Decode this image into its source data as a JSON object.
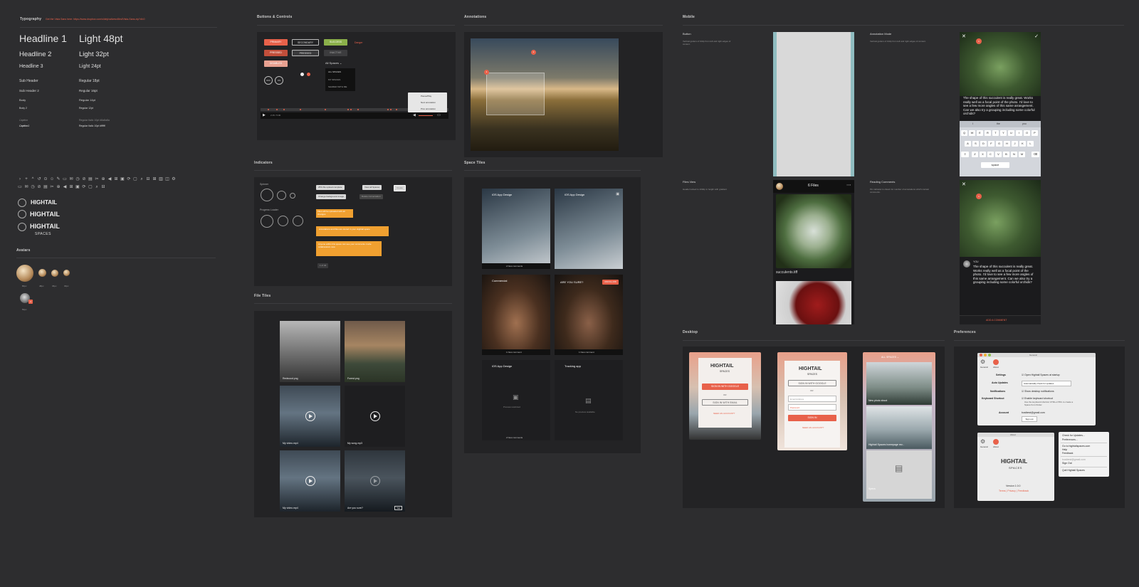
{
  "typography": {
    "title": "Typography",
    "font_note": "Get the Vista Sans here: https://www.dropbox.com/s/ldnj/xaltvesx8bnl/Vista-Sans.zip?dl=0",
    "rows": [
      {
        "left": "Headline 1",
        "right": "Light 48pt"
      },
      {
        "left": "Headline 2",
        "right": "Light 32pt"
      },
      {
        "left": "Headline 3",
        "right": "Light 24pt"
      },
      {
        "left": "Sub Header",
        "right": "Regular 18pt"
      },
      {
        "left": "Sub Header 2",
        "right": "Regular 16pt"
      },
      {
        "left": "Body",
        "right": "Regular 14pt"
      },
      {
        "left": "Body 2",
        "right": "Regular 12pt"
      },
      {
        "left": "Caption",
        "right": "Regular Italic 10pt #8a8a8a"
      },
      {
        "left": "Caption1",
        "right": "Regular Italic 10pt #ffffff"
      }
    ]
  },
  "logos": {
    "wordmark": "HIGHTAIL",
    "sub": "SPACES"
  },
  "avatars": {
    "title": "Avatars",
    "sizes": [
      "80px",
      "48px",
      "36px",
      "30px"
    ],
    "badge_size": "50px",
    "badge": "3"
  },
  "buttons": {
    "title": "Buttons & Controls",
    "primary": "PRIMARY",
    "secondary": "SECONDARY",
    "success": "SUCCESS",
    "danger": "Danger",
    "pressed1": "PRESSED",
    "pressed2": "PRESSED",
    "inactive": "INACTIVE",
    "disabled": "DISABLED",
    "dropdown_label": "All Spaces",
    "dropdown_items": [
      "ALL SPACES",
      "MY SPACES",
      "SHARED WITH ME"
    ],
    "round1": "OFF",
    "round2": "ON",
    "time": "2:15 / 5:00",
    "menu_items": [
      "Pause/Play",
      "Next annotation",
      "Prev annotation"
    ]
  },
  "indicators": {
    "title": "Indicators",
    "spinner": "Spinner",
    "progress": "Progress Loader",
    "pills": [
      "25% file upload complete",
      "View all Spaces",
      "Change background image",
      "Delete conversation",
      "Create"
    ],
    "toast1": "Files will be uploaded with all changes",
    "toast2": "Annotations and files are stored in your Hightail space",
    "toast3": "Anyone within this space can see your comments. Invite collaborators now.",
    "counter": "1 of 34"
  },
  "file_tiles": {
    "title": "File Tiles",
    "items": [
      "Redwood.png",
      "Forest.png",
      "My video.mp4",
      "My song.mp3",
      "My video.mp4",
      "Are you sure?"
    ],
    "confirm": "Yes"
  },
  "annotations": {
    "title": "Annotations",
    "pin1": "1",
    "pin2": "2"
  },
  "space_tiles": {
    "title": "Space Tiles",
    "items": [
      {
        "name": "iOS App Design",
        "foot": "2 New comments"
      },
      {
        "name": "iOS App Design",
        "foot": ""
      },
      {
        "name": "Commercial",
        "foot": "1 New comment"
      },
      {
        "name": "ARE YOU SURE?",
        "foot": "1 New comment",
        "action": "UNFOLLOW"
      },
      {
        "name": "iOS App Design",
        "foot": "2 New comments",
        "note": "Preview restricted"
      },
      {
        "name": "Tracking app",
        "foot": "",
        "note": "No preview available"
      }
    ]
  },
  "mobile": {
    "title": "Mobile",
    "button_h": "Button",
    "button_desc": "Vertical gutters of 10dp from left and right edges of content.",
    "annot_h": "Annotation Mode",
    "annot_desc": "Vertical gutters of 10dp from left and right edges of content.",
    "files_h": "Files View",
    "files_desc": "Header locked to 100dp in height with gradient",
    "reading_h": "Reading Comments",
    "reading_desc": "Pin indicator is shown for number of annotations which contain comments.",
    "files_count": "6 Files",
    "filename": "succulents.tiff",
    "comment": "The shape of this succulent is really great. Works really well as a focal point of the photo. I'd love to see a few more angles of this same arrangement. Can we also try a grouping including some colorful orchids?",
    "you": "YOU",
    "add_comment": "ADD A COMMENT",
    "kb_row1": [
      "Q",
      "W",
      "E",
      "R",
      "T",
      "Y",
      "U",
      "I",
      "O",
      "P"
    ],
    "kb_row2": [
      "A",
      "S",
      "D",
      "F",
      "G",
      "H",
      "J",
      "K",
      "L"
    ],
    "kb_row3": [
      "Z",
      "X",
      "C",
      "V",
      "B",
      "N",
      "M"
    ],
    "suggest": [
      "I",
      "the",
      "you"
    ],
    "space": "space",
    "pin": "1"
  },
  "desktop": {
    "title": "Desktop",
    "logo": "HIGHTAIL",
    "logo_sub": "SPACES",
    "google": "SIGN IN WITH GOOGLE",
    "or": "OR",
    "email_btn": "SIGN IN WITH EMAIL",
    "need": "NEED AN ACCOUNT?",
    "email_ph": "Email Address",
    "pw_ph": "Password",
    "signin": "SIGN IN",
    "all_spaces": "ALL SPACES",
    "items": [
      "New photo shoot",
      "Hightail Spaces homepage rev...",
      "Specs"
    ]
  },
  "prefs": {
    "title": "Preferences",
    "window": "General",
    "tabs": [
      "General",
      "About"
    ],
    "settings": "Settings",
    "open_start": "Open Hightail Spaces at startup",
    "auto": "Auto Updates",
    "auto_val": "Automatically check for updates",
    "notif": "Notifications",
    "notif_val": "Show desktop notifications",
    "kbd": "Keyboard Shortcut",
    "kbd_val": "Enable keyboard shortcut",
    "kbd_desc": "Use the keyboard shortcut CTRL+CTRL to create a Space from Finder",
    "account": "Account",
    "email": "bostbest@gmail.com",
    "signout": "Sign out",
    "about": "About",
    "version": "Version 1.0.0",
    "links": "Terms | Privacy | Feedback",
    "menu": [
      "Check for Updates...",
      "Preferences...",
      "Go to hightailspaces.com",
      "Help",
      "Feedback",
      "bostbest@gmail.com",
      "Sign Out",
      "Quit Hightail Spaces"
    ]
  },
  "colors": {
    "accent": "#e8614a",
    "success": "#8bb04a",
    "warning": "#f0a030",
    "bg": "#2d2d2f",
    "panel": "#232325"
  }
}
